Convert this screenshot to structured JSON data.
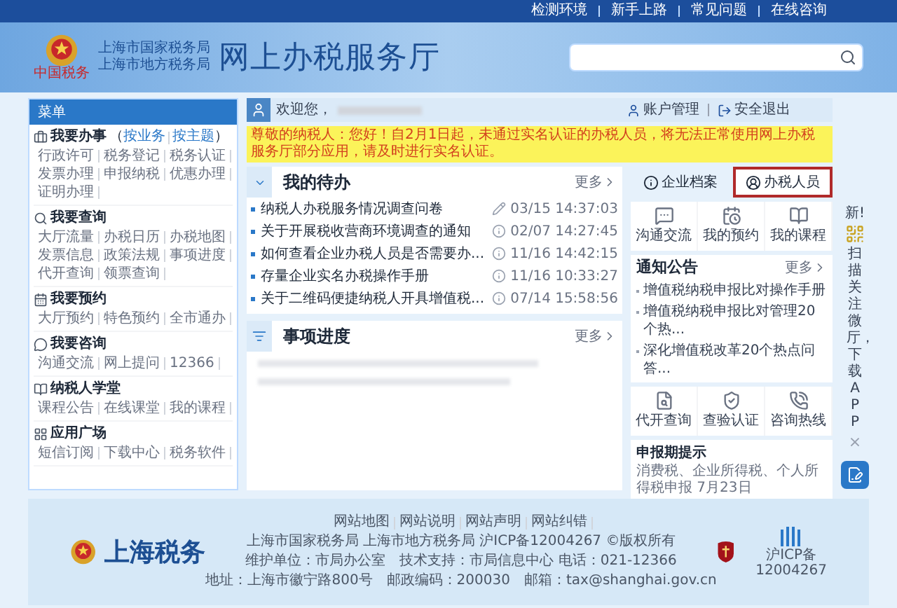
{
  "top_links": [
    "检测环境",
    "新手上路",
    "常见问题",
    "在线咨询"
  ],
  "header": {
    "emblem_caption": "中国税务",
    "org_lines": [
      "上海市国家税务局",
      "上海市地方税务局"
    ],
    "title": "网上办税服务厅"
  },
  "menu": {
    "title": "菜单",
    "sections": [
      {
        "title": "我要办事",
        "bracket_open": "（",
        "sublinks": [
          "按业务",
          "按主题"
        ],
        "bracket_close": "）",
        "items": [
          "行政许可",
          "税务登记",
          "税务认证",
          "发票办理",
          "申报纳税",
          "优惠办理",
          "证明办理"
        ]
      },
      {
        "title": "我要查询",
        "items": [
          "大厅流量",
          "办税日历",
          "办税地图",
          "发票信息",
          "政策法规",
          "事项进度",
          "代开查询",
          "领票查询"
        ]
      },
      {
        "title": "我要预约",
        "items": [
          "大厅预约",
          "特色预约",
          "全市通办"
        ]
      },
      {
        "title": "我要咨询",
        "items": [
          "沟通交流",
          "网上提问",
          "12366"
        ]
      },
      {
        "title": "纳税人学堂",
        "items": [
          "课程公告",
          "在线课堂",
          "我的课程"
        ]
      },
      {
        "title": "应用广场",
        "items": [
          "短信订阅",
          "下载中心",
          "税务软件"
        ]
      }
    ]
  },
  "greeting": {
    "welcome": "欢迎您，",
    "account": "账户管理",
    "logout": "安全退出"
  },
  "notice_banner": "尊敬的纳税人：您好！自2月1日起，未通过实名认证的办税人员，将无法正常使用网上办税服务厅部分应用，请及时进行实名认证。",
  "todo": {
    "title": "我的待办",
    "more": "更多",
    "rows": [
      {
        "kind": "survey",
        "title": "纳税人办税服务情况调查问卷",
        "date": "03/15",
        "time": "14:37:03"
      },
      {
        "kind": "notice",
        "title": "关于开展税收营商环境调查的通知",
        "date": "02/07",
        "time": "14:27:45"
      },
      {
        "kind": "notice",
        "title": "如何查看企业办税人员是否需要办...",
        "date": "11/16",
        "time": "14:42:15"
      },
      {
        "kind": "notice",
        "title": "存量企业实名办税操作手册",
        "date": "11/16",
        "time": "10:33:27"
      },
      {
        "kind": "notice",
        "title": "关于二维码便捷纳税人开具增值税...",
        "date": "07/14",
        "time": "15:58:56"
      }
    ]
  },
  "progress": {
    "title": "事项进度",
    "more": "更多"
  },
  "right": {
    "tabs": [
      {
        "label": "企业档案",
        "selected": false
      },
      {
        "label": "办税人员",
        "selected": true
      }
    ],
    "shortcuts": [
      "沟通交流",
      "我的预约",
      "我的课程"
    ],
    "announcements": {
      "title": "通知公告",
      "more": "更多",
      "items": [
        "增值税纳税申报比对操作手册",
        "增值税纳税申报比对管理20个热...",
        "深化增值税改革20个热点问答..."
      ]
    },
    "services": [
      "代开查询",
      "查验认证",
      "咨询热线"
    ],
    "reminder": {
      "title": "申报期提示",
      "text": "消费税、企业所得税、个人所得税申报 7月23日"
    }
  },
  "side_promo": {
    "badge": "新!",
    "text": "扫描关注微厅，下载APP",
    "close": "×"
  },
  "footer": {
    "brand": "上海税务",
    "links": [
      "网站地图",
      "网站说明",
      "网站声明",
      "网站纠错"
    ],
    "lines": [
      "上海市国家税务局 上海市地方税务局 沪ICP备12004267 ©版权所有",
      "维护单位：市局办公室　技术支持：市局信息中心 电话：021-12366",
      "地址：上海市徽宁路800号　邮政编码：200030　邮箱：tax@shanghai.gov.cn"
    ],
    "icp": [
      "沪ICP备",
      "12004267"
    ]
  }
}
